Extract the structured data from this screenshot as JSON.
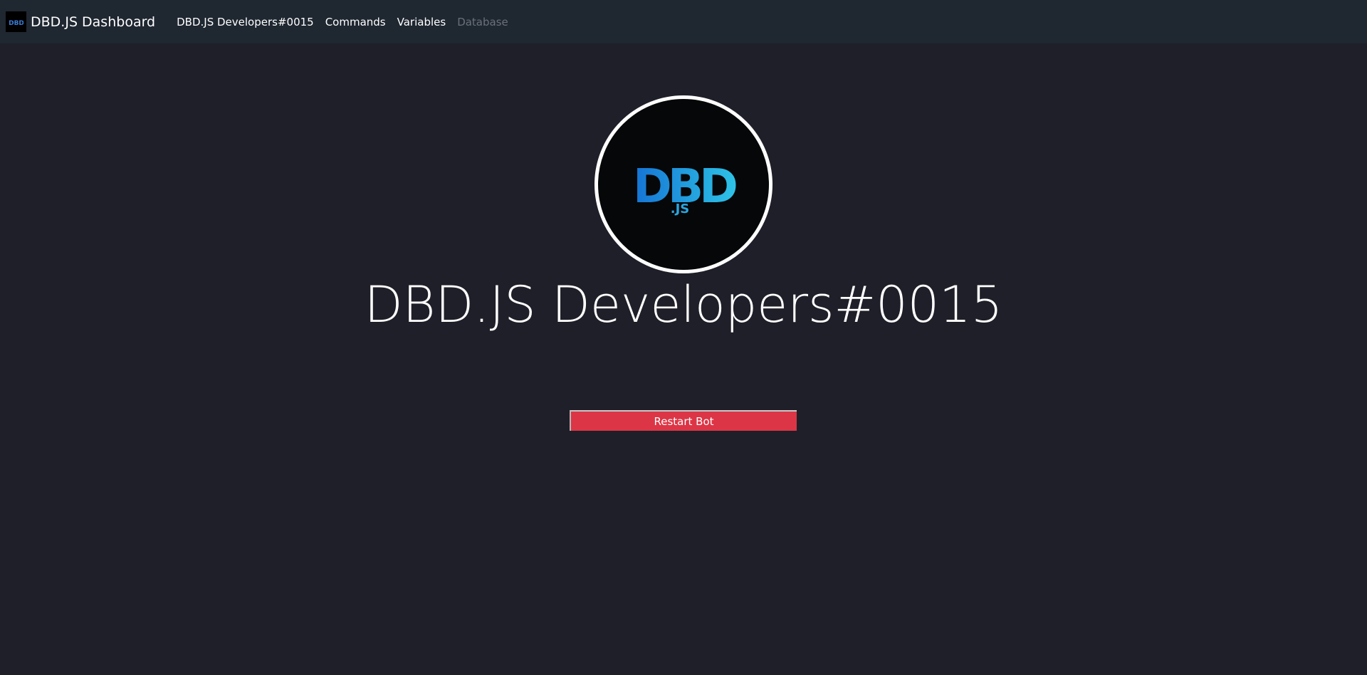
{
  "navbar": {
    "brand_title": "DBD.JS Dashboard",
    "brand_logo_text": "DBD",
    "links": [
      {
        "label": "DBD.JS Developers#0015",
        "enabled": true
      },
      {
        "label": "Commands",
        "enabled": true
      },
      {
        "label": "Variables",
        "enabled": true
      },
      {
        "label": "Database",
        "enabled": false
      }
    ]
  },
  "profile": {
    "avatar_logo_main": "DBD",
    "avatar_logo_sub": ".JS",
    "bot_name": "DBD.JS Developers#0015"
  },
  "actions": {
    "restart_label": "Restart Bot"
  },
  "colors": {
    "page_background": "#1f1f29",
    "navbar_background": "#1f2731",
    "danger": "#dc3545",
    "logo_blue_dark": "#1573d4",
    "logo_blue_light": "#2ec3e6",
    "disabled_link": "#6b7079"
  }
}
